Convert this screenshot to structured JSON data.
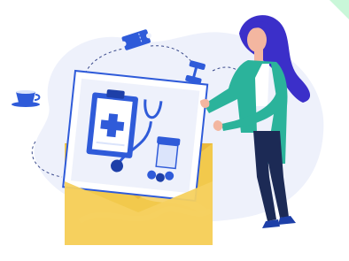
{
  "illustration": {
    "subject": "woman-placing-medical-card-in-envelope",
    "icons": [
      "ticket-icon",
      "dumbbell-icon",
      "coffee-cup-icon",
      "clipboard-icon",
      "stethoscope-icon",
      "pill-bottle-icon",
      "medical-cross-icon"
    ]
  },
  "palette": {
    "background": "#ffffff",
    "blob": "#eef1fb",
    "accent_blue": "#2f5bd9",
    "light_blue": "#dbe4fb",
    "envelope_gold": "#f2c94c",
    "envelope_light": "#f8dc8a",
    "hair_purple": "#3b2fc9",
    "coat_green": "#2bb39b",
    "pants_navy": "#1c2a55",
    "skin": "#f3b6a0",
    "dashed_line": "#3a4a8c",
    "corner_accent": "#c9f7d9"
  }
}
